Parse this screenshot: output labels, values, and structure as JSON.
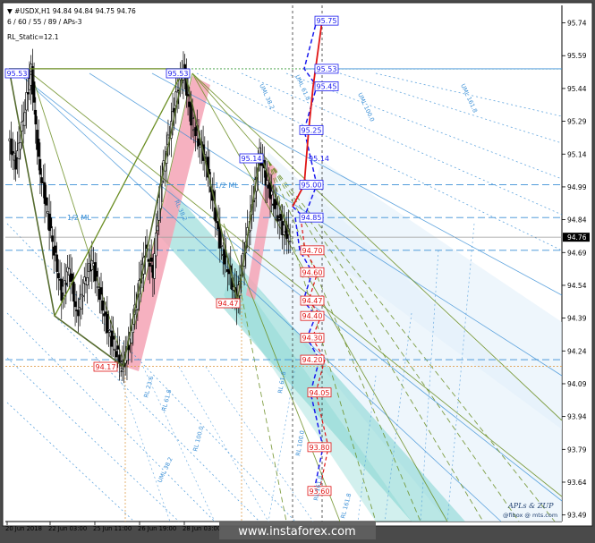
{
  "header": {
    "symbol_line": "▼ #USDX,H1  94.84 94.84 94.75 94.76",
    "params_line": "6 / 60 / 55 / 89 / APs-3",
    "rl_static": "RL_Static=12.1"
  },
  "watermark": "www.instaforex.com",
  "brand": {
    "line1": "APLs & ZUP",
    "line2": "@fibox @ mts.com"
  },
  "colors": {
    "bull_candle": "#000000",
    "bear_candle": "#000000",
    "pink_fill": "#f4a3b5",
    "teal_fill": "#7fd3cf",
    "blue_target": "#1a1aee",
    "red_target": "#e01515",
    "fork_green": "#6b8e23",
    "fib_blue": "#3a8fd6",
    "current_price_bg": "#000000"
  },
  "chart_data": {
    "type": "candlestick",
    "symbol": "#USDX",
    "timeframe": "H1",
    "ylim": [
      93.46,
      95.82
    ],
    "current_price": 94.76,
    "y_ticks": [
      95.74,
      95.59,
      95.44,
      95.29,
      95.14,
      94.99,
      94.84,
      94.76,
      94.69,
      94.54,
      94.39,
      94.24,
      94.09,
      93.94,
      93.79,
      93.64,
      93.49
    ],
    "x_ticks": [
      "20 Jun 2018",
      "22 Jun 03:00",
      "25 Jun 11:00",
      "26 Jun 19:00",
      "28 Jun 03:00"
    ],
    "price_path": [
      95.2,
      95.1,
      95.3,
      95.53,
      95.1,
      94.9,
      94.7,
      94.5,
      94.62,
      94.4,
      94.55,
      94.65,
      94.5,
      94.35,
      94.25,
      94.17,
      94.3,
      94.5,
      94.7,
      94.6,
      95.0,
      95.2,
      95.4,
      95.53,
      95.3,
      95.2,
      95.1,
      94.9,
      94.7,
      94.6,
      94.47,
      94.7,
      94.9,
      95.14,
      95.0,
      94.9,
      94.8,
      94.76
    ],
    "zigzag": [
      {
        "t": 0,
        "p": 95.53
      },
      {
        "t": 6,
        "p": 94.4
      },
      {
        "t": 15,
        "p": 94.17
      },
      {
        "t": 23,
        "p": 95.53
      },
      {
        "t": 30,
        "p": 94.47
      },
      {
        "t": 33,
        "p": 95.14
      },
      {
        "t": 37,
        "p": 94.76
      }
    ],
    "pivot_labels": [
      {
        "label": "95.53",
        "price": 95.53,
        "kind": "blue"
      },
      {
        "label": "95.53",
        "price": 95.53,
        "kind": "blue"
      },
      {
        "label": "94.17",
        "price": 94.17,
        "kind": "red"
      },
      {
        "label": "95.14",
        "price": 95.14,
        "kind": "blue"
      },
      {
        "label": "94.47",
        "price": 94.47,
        "kind": "red"
      }
    ],
    "blue_targets": [
      95.75,
      95.53,
      95.45,
      95.25,
      95.0,
      94.85
    ],
    "red_targets": [
      94.7,
      94.6,
      94.47,
      94.4,
      94.3,
      94.2,
      94.05,
      93.8,
      93.6
    ],
    "level_note": "95.14",
    "ml_labels": [
      "1/2 ML",
      "1/2 ML"
    ],
    "fib_labels": [
      "UML 38.2",
      "UML 61.8",
      "UML 100.0",
      "UML 161.8",
      "RL 38.2",
      "RL 23.6",
      "RL 61.8",
      "RL 100.0",
      "UML 38.2",
      "RL 161.8",
      "RL 61.8",
      "RL 100.0",
      "RL 161.8"
    ],
    "pivot_marks": [
      "0",
      "2"
    ],
    "hlines": [
      {
        "price": 95.53,
        "style": "dotted-green"
      },
      {
        "price": 95.53,
        "style": "solid-blue"
      },
      {
        "price": 95.0,
        "style": "dashed-blue"
      },
      {
        "price": 94.85,
        "style": "dashed-blue"
      },
      {
        "price": 94.7,
        "style": "dashed-blue"
      },
      {
        "price": 94.2,
        "style": "dashed-blue"
      },
      {
        "price": 94.17,
        "style": "dotted-orange"
      }
    ]
  }
}
